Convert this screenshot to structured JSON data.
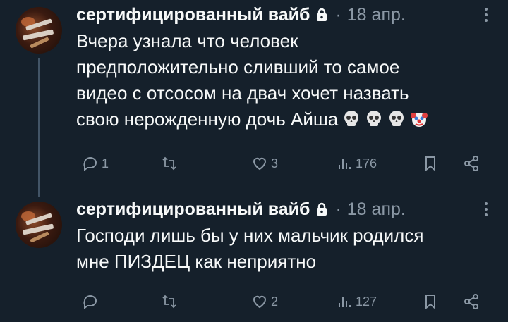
{
  "tweets": [
    {
      "author": "сертифицированный вайб",
      "separator": "·",
      "date": "18 апр.",
      "lines": [
        "Вчера узнала что человек",
        "предположительно сливший то самое",
        "видео с отсосом на двач хочет назвать",
        "свою нерожденную дочь Айша"
      ],
      "emojis": [
        "skull-emoji",
        "skull-emoji",
        "skull-emoji",
        "clown-emoji"
      ],
      "actions": {
        "replies": "1",
        "retweets": "",
        "likes": "3",
        "views": "176"
      }
    },
    {
      "author": "сертифицированный вайб",
      "separator": "·",
      "date": "18 апр.",
      "lines": [
        "Господи лишь бы у них мальчик родился",
        "мне ПИЗДЕЦ как неприятно"
      ],
      "emojis": [],
      "actions": {
        "replies": "",
        "retweets": "",
        "likes": "2",
        "views": "127"
      }
    }
  ],
  "colors": {
    "background": "#15202b",
    "text": "#f7f9f9",
    "secondary": "#8b98a5",
    "thread_line": "#425466"
  }
}
